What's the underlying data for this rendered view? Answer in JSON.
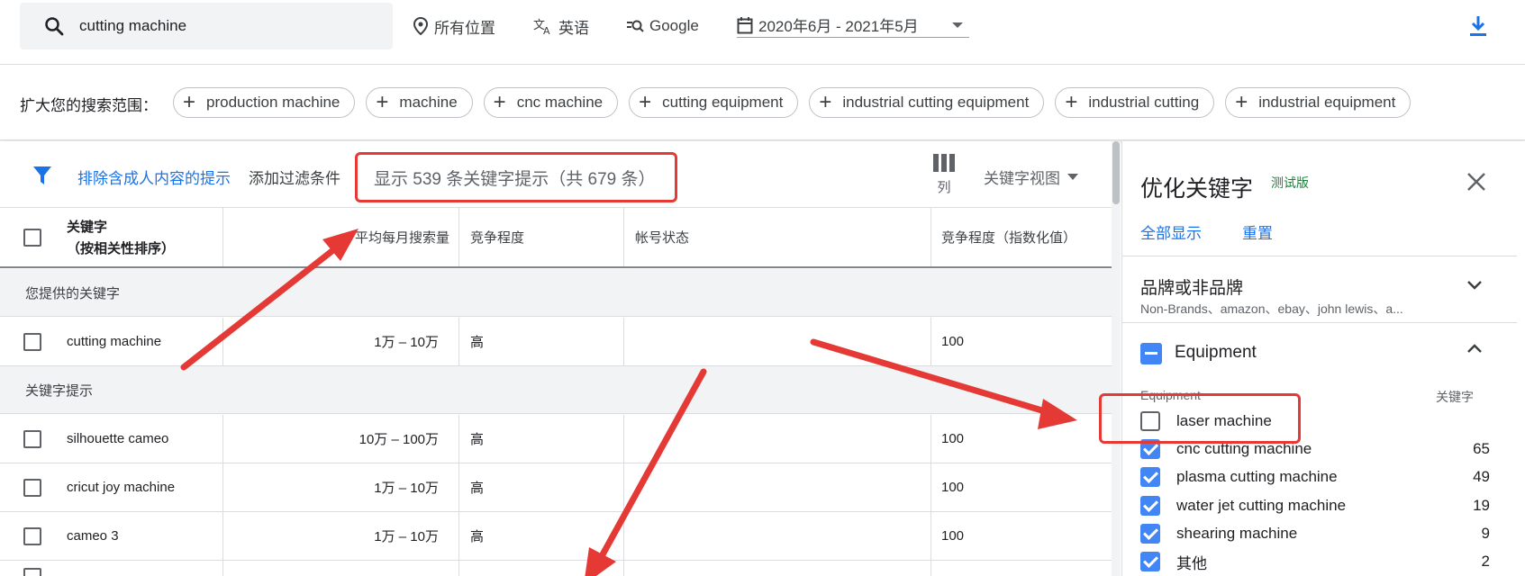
{
  "search": {
    "query": "cutting machine"
  },
  "topbar": {
    "location": "所有位置",
    "language": "英语",
    "network": "Google",
    "date_range": "2020年6月 - 2021年5月"
  },
  "expand": {
    "label": "扩大您的搜索范围：",
    "chips": [
      "production machine",
      "machine",
      "cnc machine",
      "cutting equipment",
      "industrial cutting equipment",
      "industrial cutting",
      "industrial equipment"
    ]
  },
  "toolbar": {
    "exclude_adult": "排除含成人内容的提示",
    "add_filter": "添加过滤条件",
    "result_count": "显示 539 条关键字提示（共 679 条）",
    "columns_label": "列",
    "keyword_view": "关键字视图"
  },
  "table": {
    "headers": {
      "keyword": "关键字",
      "keyword_sub": "（按相关性排序）",
      "avg_searches": "平均每月搜索量",
      "competition": "竞争程度",
      "account_status": "帐号状态",
      "competition_index": "竞争程度（指数化值）"
    },
    "provided_section": "您提供的关键字",
    "provided_rows": [
      {
        "keyword": "cutting machine",
        "searches": "1万 – 10万",
        "competition": "高",
        "status": "",
        "index": "100"
      }
    ],
    "ideas_section": "关键字提示",
    "idea_rows": [
      {
        "keyword": "silhouette cameo",
        "searches": "10万 – 100万",
        "competition": "高",
        "status": "",
        "index": "100"
      },
      {
        "keyword": "cricut joy machine",
        "searches": "1万 – 10万",
        "competition": "高",
        "status": "",
        "index": "100"
      },
      {
        "keyword": "cameo 3",
        "searches": "1万 – 10万",
        "competition": "高",
        "status": "",
        "index": "100"
      }
    ]
  },
  "panel": {
    "title": "优化关键字",
    "beta": "测试版",
    "show_all": "全部显示",
    "reset": "重置",
    "brand": {
      "title": "品牌或非品牌",
      "subtitle": "Non-Brands、amazon、ebay、john lewis、a..."
    },
    "equipment": {
      "title": "Equipment",
      "col_name": "Equipment",
      "col_count": "关键字",
      "items": [
        {
          "label": "laser machine",
          "count": "",
          "checked": false
        },
        {
          "label": "cnc cutting machine",
          "count": "65",
          "checked": true
        },
        {
          "label": "plasma cutting machine",
          "count": "49",
          "checked": true
        },
        {
          "label": "water jet cutting machine",
          "count": "19",
          "checked": true
        },
        {
          "label": "shearing machine",
          "count": "9",
          "checked": true
        },
        {
          "label": "其他",
          "count": "2",
          "checked": true
        }
      ]
    }
  },
  "colors": {
    "accent": "#1a73e8",
    "checkbox": "#4285f4",
    "annotation": "#e53935",
    "beta": "#188038"
  }
}
